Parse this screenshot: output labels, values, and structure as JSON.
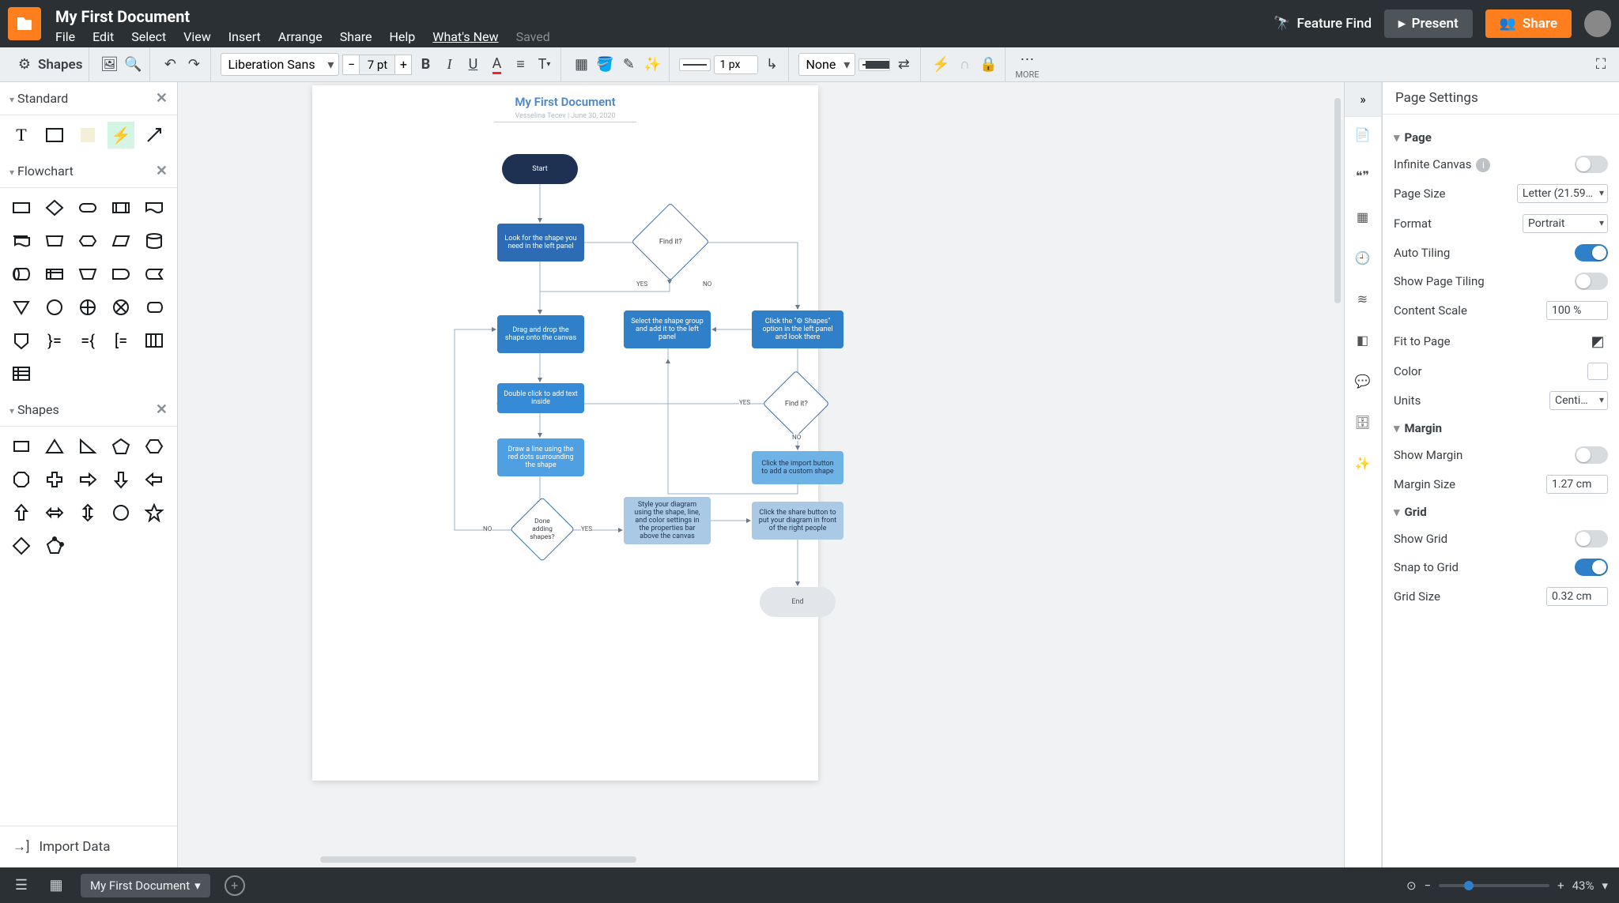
{
  "header": {
    "doc_title": "My First Document",
    "menu": {
      "file": "File",
      "edit": "Edit",
      "select": "Select",
      "view": "View",
      "insert": "Insert",
      "arrange": "Arrange",
      "share": "Share",
      "help": "Help",
      "whatsnew": "What's New",
      "saved": "Saved"
    },
    "feature_find": "Feature Find",
    "present": "Present",
    "share_btn": "Share"
  },
  "toolbar": {
    "shapes_label": "Shapes",
    "font_family": "Liberation Sans",
    "font_size": "7 pt",
    "stroke_width": "1 px",
    "fill_none": "None",
    "more": "MORE"
  },
  "left": {
    "standard": "Standard",
    "flowchart": "Flowchart",
    "shapes": "Shapes",
    "import": "Import Data"
  },
  "canvas": {
    "page_title": "My First Document",
    "page_sub": "Vesselina Tecev  |  June 30, 2020",
    "start": "Start",
    "n1": "Look for the shape you need in the left panel",
    "dia1": "Find it?",
    "n2": "Drag and drop the shape onto the canvas",
    "n3": "Double click to add text inside",
    "n4": "Draw a line using the red dots surrounding the shape",
    "dia2": "Done adding shapes?",
    "n5": "Select the shape group and add it to the left panel",
    "n6": "Click the \"⚙ Shapes\" option in the left panel and look there",
    "dia3": "Find it?",
    "n7": "Click the import button to add a custom shape",
    "n8": "Style your diagram using the shape, line, and color settings in the properties bar above the canvas",
    "n9": "Click the share button to put your diagram in front of the right people",
    "end": "End",
    "yes": "YES",
    "no": "NO"
  },
  "right": {
    "title": "Page Settings",
    "page_h": "Page",
    "infinite": "Infinite Canvas",
    "page_size": "Page Size",
    "page_size_v": "Letter (21.59…",
    "format": "Format",
    "format_v": "Portrait",
    "auto_tiling": "Auto Tiling",
    "show_tiling": "Show Page Tiling",
    "content_scale": "Content Scale",
    "content_scale_v": "100 %",
    "fit": "Fit to Page",
    "color": "Color",
    "units": "Units",
    "units_v": "Centi…",
    "margin_h": "Margin",
    "show_margin": "Show Margin",
    "margin_size": "Margin Size",
    "margin_size_v": "1.27 cm",
    "grid_h": "Grid",
    "show_grid": "Show Grid",
    "snap_grid": "Snap to Grid",
    "grid_size": "Grid Size",
    "grid_size_v": "0.32 cm"
  },
  "bottom": {
    "doc_name": "My First Document",
    "zoom": "43%"
  }
}
